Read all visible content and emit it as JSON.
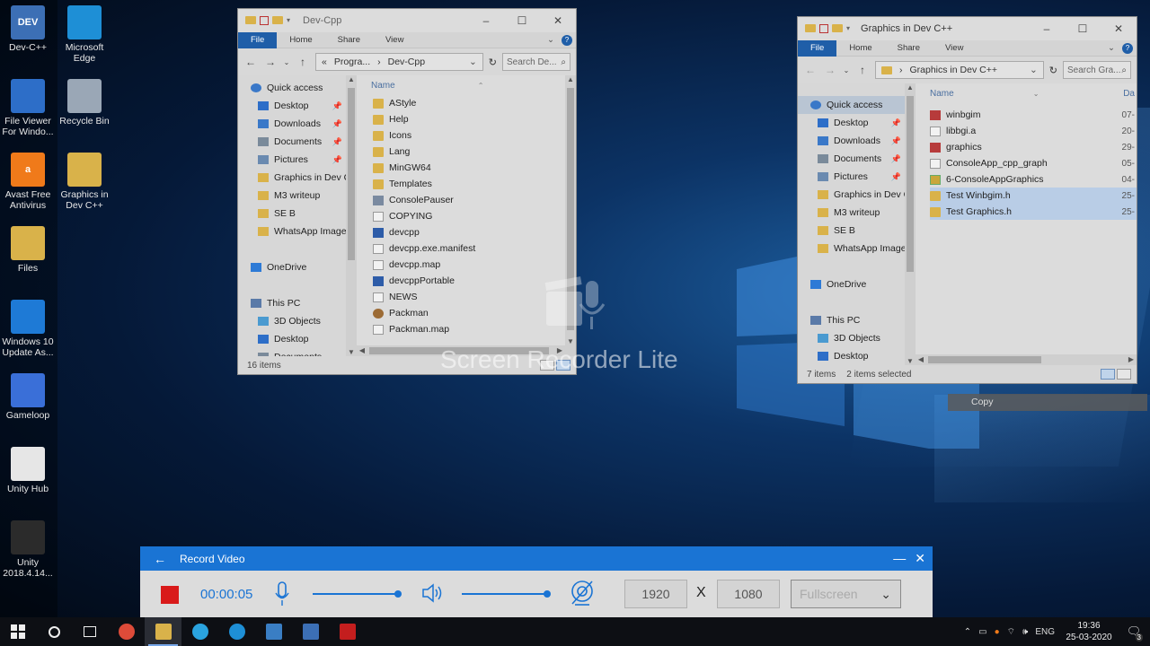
{
  "desktop_icons": [
    {
      "label": "Dev-C++",
      "icon": "devcpp-icon",
      "badge": "DEV",
      "color": "#3c6fb5"
    },
    {
      "label": "Microsoft Edge",
      "icon": "edge-icon",
      "color": "#1e8fd6"
    },
    {
      "label": "File Viewer For Windo...",
      "icon": "file-viewer-icon",
      "color": "#2d6ec8"
    },
    {
      "label": "Recycle Bin",
      "icon": "recycle-bin-icon",
      "color": "#9aa7b6"
    },
    {
      "label": "Avast Free Antivirus",
      "icon": "avast-icon",
      "badge": "a",
      "color": "#f07a1a"
    },
    {
      "label": "Graphics in Dev C++",
      "icon": "folder-icon",
      "color": "#d9b24a"
    },
    {
      "label": "Files",
      "icon": "files-icon",
      "color": "#d9b24a"
    },
    {
      "label": "Windows 10 Update As...",
      "icon": "windows-update-icon",
      "color": "#1e7ad6"
    },
    {
      "label": "Gameloop",
      "icon": "gameloop-icon",
      "color": "#3a6fd8"
    },
    {
      "label": "Unity Hub",
      "icon": "unity-hub-icon",
      "color": "#e6e6e6"
    },
    {
      "label": "Unity 2018.4.14...",
      "icon": "unity-icon",
      "color": "#2b2b2b"
    }
  ],
  "explorer1": {
    "title": "Dev-Cpp",
    "ribbon": {
      "file": "File",
      "tabs": [
        "Home",
        "Share",
        "View"
      ]
    },
    "breadcrumb": [
      "«",
      "Progra...",
      "›",
      "Dev-Cpp"
    ],
    "search_placeholder": "Search De...",
    "nav": [
      {
        "label": "Quick access",
        "icon": "star-icon",
        "level": 0,
        "pinned": false
      },
      {
        "label": "Desktop",
        "icon": "desktop-icon",
        "level": 1,
        "pinned": true
      },
      {
        "label": "Downloads",
        "icon": "download-icon",
        "level": 1,
        "pinned": true
      },
      {
        "label": "Documents",
        "icon": "documents-icon",
        "level": 1,
        "pinned": true
      },
      {
        "label": "Pictures",
        "icon": "pictures-icon",
        "level": 1,
        "pinned": true
      },
      {
        "label": "Graphics in Dev C",
        "icon": "folder-icon",
        "level": 1,
        "pinned": false
      },
      {
        "label": "M3 writeup",
        "icon": "folder-icon",
        "level": 1,
        "pinned": false
      },
      {
        "label": "SE B",
        "icon": "folder-icon",
        "level": 1,
        "pinned": false
      },
      {
        "label": "WhatsApp Image",
        "icon": "folder-icon",
        "level": 1,
        "pinned": false
      },
      {
        "label": "",
        "icon": "",
        "level": 0,
        "pinned": false
      },
      {
        "label": "OneDrive",
        "icon": "cloud-icon",
        "level": 0,
        "pinned": false
      },
      {
        "label": "",
        "icon": "",
        "level": 0,
        "pinned": false
      },
      {
        "label": "This PC",
        "icon": "pc-icon",
        "level": 0,
        "pinned": false
      },
      {
        "label": "3D Objects",
        "icon": "cube-icon",
        "level": 1,
        "pinned": false
      },
      {
        "label": "Desktop",
        "icon": "desktop-icon",
        "level": 1,
        "pinned": false
      },
      {
        "label": "Documents",
        "icon": "documents-icon",
        "level": 1,
        "pinned": false
      }
    ],
    "column_name": "Name",
    "files": [
      {
        "name": "AStyle",
        "type": "folder"
      },
      {
        "name": "Help",
        "type": "folder"
      },
      {
        "name": "Icons",
        "type": "folder"
      },
      {
        "name": "Lang",
        "type": "folder"
      },
      {
        "name": "MinGW64",
        "type": "folder"
      },
      {
        "name": "Templates",
        "type": "folder"
      },
      {
        "name": "ConsolePauser",
        "type": "grey"
      },
      {
        "name": "COPYING",
        "type": "doc"
      },
      {
        "name": "devcpp",
        "type": "app"
      },
      {
        "name": "devcpp.exe.manifest",
        "type": "doc"
      },
      {
        "name": "devcpp.map",
        "type": "doc"
      },
      {
        "name": "devcppPortable",
        "type": "app"
      },
      {
        "name": "NEWS",
        "type": "doc"
      },
      {
        "name": "Packman",
        "type": "brown"
      },
      {
        "name": "Packman.map",
        "type": "doc"
      }
    ],
    "status": "16 items"
  },
  "explorer2": {
    "title": "Graphics in Dev C++",
    "ribbon": {
      "file": "File",
      "tabs": [
        "Home",
        "Share",
        "View"
      ]
    },
    "breadcrumb": [
      "›",
      "Graphics in Dev C++"
    ],
    "search_placeholder": "Search Gra...",
    "nav": [
      {
        "label": "Quick access",
        "icon": "star-icon",
        "level": 0,
        "pinned": false,
        "selected": true
      },
      {
        "label": "Desktop",
        "icon": "desktop-icon",
        "level": 1,
        "pinned": true
      },
      {
        "label": "Downloads",
        "icon": "download-icon",
        "level": 1,
        "pinned": true
      },
      {
        "label": "Documents",
        "icon": "documents-icon",
        "level": 1,
        "pinned": true
      },
      {
        "label": "Pictures",
        "icon": "pictures-icon",
        "level": 1,
        "pinned": true
      },
      {
        "label": "Graphics in Dev C",
        "icon": "folder-icon",
        "level": 1,
        "pinned": false
      },
      {
        "label": "M3 writeup",
        "icon": "folder-icon",
        "level": 1,
        "pinned": false
      },
      {
        "label": "SE B",
        "icon": "folder-icon",
        "level": 1,
        "pinned": false
      },
      {
        "label": "WhatsApp Image",
        "icon": "folder-icon",
        "level": 1,
        "pinned": false
      },
      {
        "label": "",
        "icon": "",
        "level": 0,
        "pinned": false
      },
      {
        "label": "OneDrive",
        "icon": "cloud-icon",
        "level": 0,
        "pinned": false
      },
      {
        "label": "",
        "icon": "",
        "level": 0,
        "pinned": false
      },
      {
        "label": "This PC",
        "icon": "pc-icon",
        "level": 0,
        "pinned": false
      },
      {
        "label": "3D Objects",
        "icon": "cube-icon",
        "level": 1,
        "pinned": false
      },
      {
        "label": "Desktop",
        "icon": "desktop-icon",
        "level": 1,
        "pinned": false
      },
      {
        "label": "Documents",
        "icon": "documents-icon",
        "level": 1,
        "pinned": false
      }
    ],
    "column_name": "Name",
    "column_date": "Da",
    "files": [
      {
        "name": "winbgim",
        "type": "red",
        "date": "07-",
        "selected": false
      },
      {
        "name": "libbgi.a",
        "type": "doc",
        "date": "20-",
        "selected": false
      },
      {
        "name": "graphics",
        "type": "red",
        "date": "29-",
        "selected": false
      },
      {
        "name": "ConsoleApp_cpp_graph",
        "type": "doc",
        "date": "05-",
        "selected": false
      },
      {
        "name": "6-ConsoleAppGraphics",
        "type": "yfold",
        "date": "04-",
        "selected": false
      },
      {
        "name": "Test Winbgim.h",
        "type": "folder",
        "date": "25-",
        "selected": true
      },
      {
        "name": "Test Graphics.h",
        "type": "folder",
        "date": "25-",
        "selected": true
      }
    ],
    "status_items": "7 items",
    "status_selected": "2 items selected"
  },
  "watermark": "Screen Recorder Lite",
  "copy_tooltip": "Copy",
  "recorder": {
    "title": "Record Video",
    "timer": "00:00:05",
    "mic_level": 0.95,
    "speaker_level": 0.95,
    "width": "1920",
    "x_label": "X",
    "height": "1080",
    "mode": "Fullscreen"
  },
  "taskbar": {
    "apps": [
      {
        "name": "chrome-icon",
        "color": "#dd4b39"
      },
      {
        "name": "file-explorer-icon",
        "color": "#d9b24a",
        "active": true
      },
      {
        "name": "telegram-icon",
        "color": "#2aa3df"
      },
      {
        "name": "edge-taskbar-icon",
        "color": "#1e8fd6"
      },
      {
        "name": "app-window-icon",
        "color": "#3a7ec4"
      },
      {
        "name": "devcpp-taskbar-icon",
        "color": "#3c6fb5"
      },
      {
        "name": "recorder-taskbar-icon",
        "color": "#c41e1e"
      }
    ],
    "lang": "ENG",
    "time": "19:36",
    "date": "25-03-2020",
    "notifications": "3"
  }
}
